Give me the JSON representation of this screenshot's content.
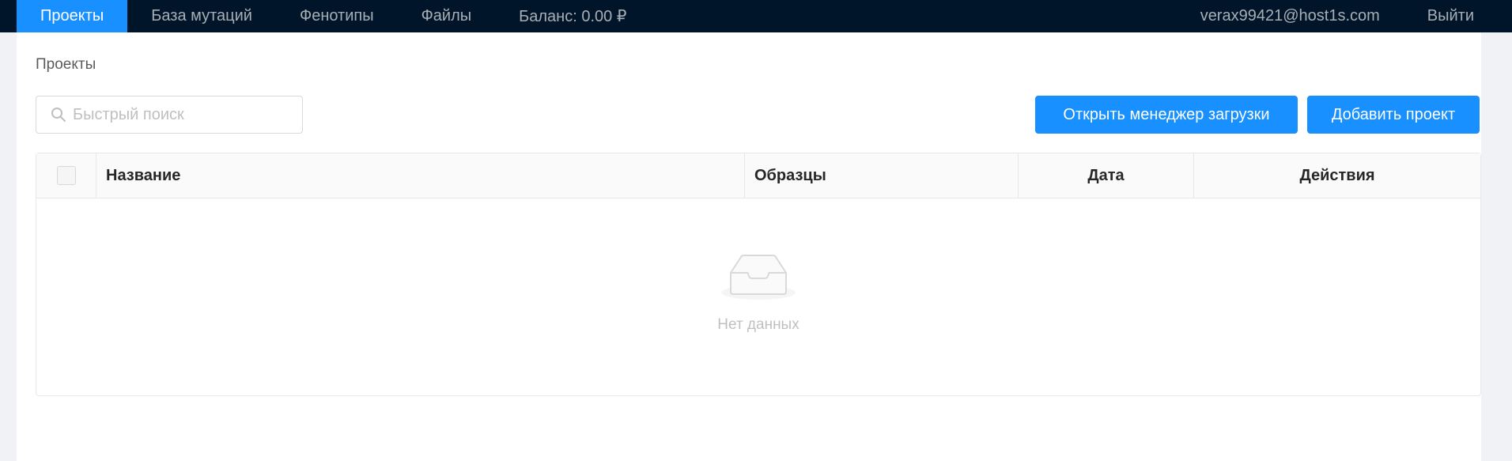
{
  "nav": {
    "items": [
      {
        "label": "Проекты",
        "active": true
      },
      {
        "label": "База мутаций",
        "active": false
      },
      {
        "label": "Фенотипы",
        "active": false
      },
      {
        "label": "Файлы",
        "active": false
      },
      {
        "label": "Баланс: 0.00 ₽",
        "active": false
      }
    ],
    "user_email": "verax99421@host1s.com",
    "logout_label": "Выйти"
  },
  "breadcrumb": "Проекты",
  "search": {
    "placeholder": "Быстрый поиск",
    "value": ""
  },
  "buttons": {
    "upload_manager": "Открыть менеджер загрузки",
    "add_project": "Добавить проект"
  },
  "table": {
    "columns": [
      "Название",
      "Образцы",
      "Дата",
      "Действия"
    ],
    "empty_text": "Нет данных"
  },
  "colors": {
    "nav_bg": "#001529",
    "accent": "#1890ff"
  }
}
